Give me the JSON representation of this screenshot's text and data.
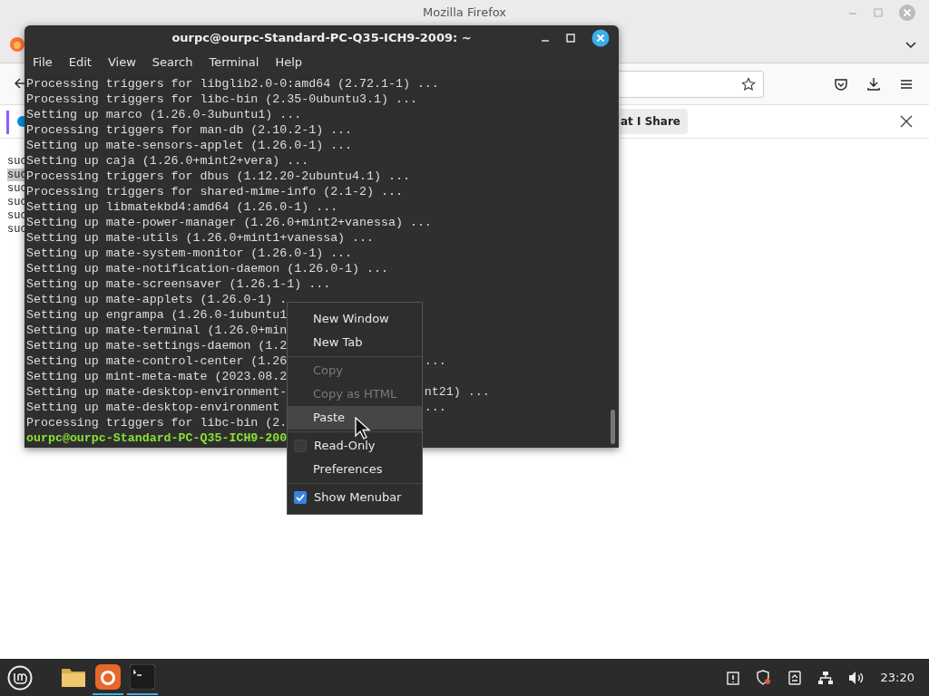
{
  "browser": {
    "title": "Mozilla Firefox",
    "notification_button": "at I Share",
    "page_lines": [
      {
        "text": "suc",
        "selected": false
      },
      {
        "text": "suc",
        "selected": true
      },
      {
        "text": "suc",
        "selected": false
      },
      {
        "text": "suc",
        "selected": false
      },
      {
        "text": "suc",
        "selected": false
      },
      {
        "text": "suc",
        "selected": false
      }
    ]
  },
  "terminal": {
    "title": "ourpc@ourpc-Standard-PC-Q35-ICH9-2009: ~",
    "menu": [
      "File",
      "Edit",
      "View",
      "Search",
      "Terminal",
      "Help"
    ],
    "lines": [
      {
        "kind": "output",
        "text": "Processing triggers for libglib2.0-0:amd64 (2.72.1-1) ..."
      },
      {
        "kind": "output",
        "text": "Processing triggers for libc-bin (2.35-0ubuntu3.1) ..."
      },
      {
        "kind": "output",
        "text": "Setting up marco (1.26.0-3ubuntu1) ..."
      },
      {
        "kind": "output",
        "text": "Processing triggers for man-db (2.10.2-1) ..."
      },
      {
        "kind": "output",
        "text": "Setting up mate-sensors-applet (1.26.0-1) ..."
      },
      {
        "kind": "output",
        "text": "Setting up caja (1.26.0+mint2+vera) ..."
      },
      {
        "kind": "output",
        "text": "Processing triggers for dbus (1.12.20-2ubuntu4.1) ..."
      },
      {
        "kind": "output",
        "text": "Processing triggers for shared-mime-info (2.1-2) ..."
      },
      {
        "kind": "output",
        "text": "Setting up libmatekbd4:amd64 (1.26.0-1) ..."
      },
      {
        "kind": "output",
        "text": "Setting up mate-power-manager (1.26.0+mint2+vanessa) ..."
      },
      {
        "kind": "output",
        "text": "Setting up mate-utils (1.26.0+mint1+vanessa) ..."
      },
      {
        "kind": "output",
        "text": "Setting up mate-system-monitor (1.26.0-1) ..."
      },
      {
        "kind": "output",
        "text": "Setting up mate-notification-daemon (1.26.0-1) ..."
      },
      {
        "kind": "output",
        "text": "Setting up mate-screensaver (1.26.1-1) ..."
      },
      {
        "kind": "output",
        "text": "Setting up mate-applets (1.26.0-1) ."
      },
      {
        "kind": "output",
        "text": "Setting up engrampa (1.26.0-1ubuntu1"
      },
      {
        "kind": "output",
        "text": "Setting up mate-terminal (1.26.0+min"
      },
      {
        "kind": "output",
        "text": "Setting up mate-settings-daemon (1.2"
      },
      {
        "kind": "output",
        "text": "Setting up mate-control-center (1.26",
        "tail": "..."
      },
      {
        "kind": "output",
        "text": "Setting up mint-meta-mate (2023.08.2"
      },
      {
        "kind": "output",
        "text": "Setting up mate-desktop-environment-",
        "tail": "nt21) ..."
      },
      {
        "kind": "output",
        "text": "Setting up mate-desktop-environment",
        "tail": "..."
      },
      {
        "kind": "output",
        "text": "Processing triggers for libc-bin (2."
      },
      {
        "kind": "prompt",
        "text": "ourpc@ourpc-Standard-PC-Q35-ICH9-200"
      }
    ]
  },
  "context_menu": [
    {
      "kind": "item",
      "label": "New Window",
      "disabled": false,
      "selected": false
    },
    {
      "kind": "item",
      "label": "New Tab",
      "disabled": false,
      "selected": false
    },
    {
      "kind": "separator"
    },
    {
      "kind": "item",
      "label": "Copy",
      "disabled": true,
      "selected": false
    },
    {
      "kind": "item",
      "label": "Copy as HTML",
      "disabled": true,
      "selected": false
    },
    {
      "kind": "item",
      "label": "Paste",
      "disabled": false,
      "selected": true
    },
    {
      "kind": "separator"
    },
    {
      "kind": "check",
      "label": "Read-Only",
      "checked": false
    },
    {
      "kind": "item",
      "label": "Preferences",
      "disabled": false,
      "selected": false
    },
    {
      "kind": "separator"
    },
    {
      "kind": "check",
      "label": "Show Menubar",
      "checked": true
    }
  ],
  "taskbar": {
    "apps": [
      {
        "kind": "folder",
        "selected": false
      },
      {
        "kind": "firefox",
        "selected": true
      },
      {
        "kind": "terminal",
        "selected": true
      }
    ],
    "clock": "23:20"
  }
}
